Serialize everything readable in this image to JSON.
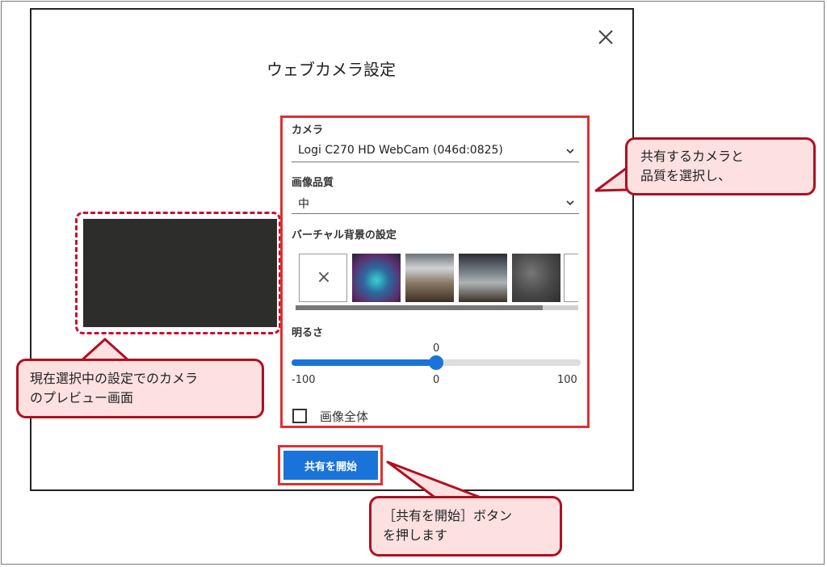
{
  "dialog": {
    "title": "ウェブカメラ設定",
    "close_icon": "close-icon",
    "camera": {
      "label": "カメラ",
      "value": "Logi C270 HD WebCam (046d:0825)"
    },
    "quality": {
      "label": "画像品質",
      "value": "中"
    },
    "virtual_bg": {
      "label": "バーチャル背景の設定",
      "none_symbol": "×"
    },
    "brightness": {
      "label": "明るさ",
      "value": "0",
      "min": "-100",
      "mid": "0",
      "max": "100",
      "fraction": 0.5
    },
    "full_image": {
      "label": "画像全体",
      "checked": false
    },
    "share_button": "共有を開始"
  },
  "callouts": {
    "select": "共有するカメラと\n品質を選択し、",
    "preview": "現在選択中の設定でのカメラ\nのプレビュー画面",
    "button": "［共有を開始］ボタン\nを押します"
  },
  "colors": {
    "accent": "#1a73d9",
    "highlight": "#e03030",
    "callout_bg": "#fde1e1",
    "callout_border": "#b01020"
  }
}
